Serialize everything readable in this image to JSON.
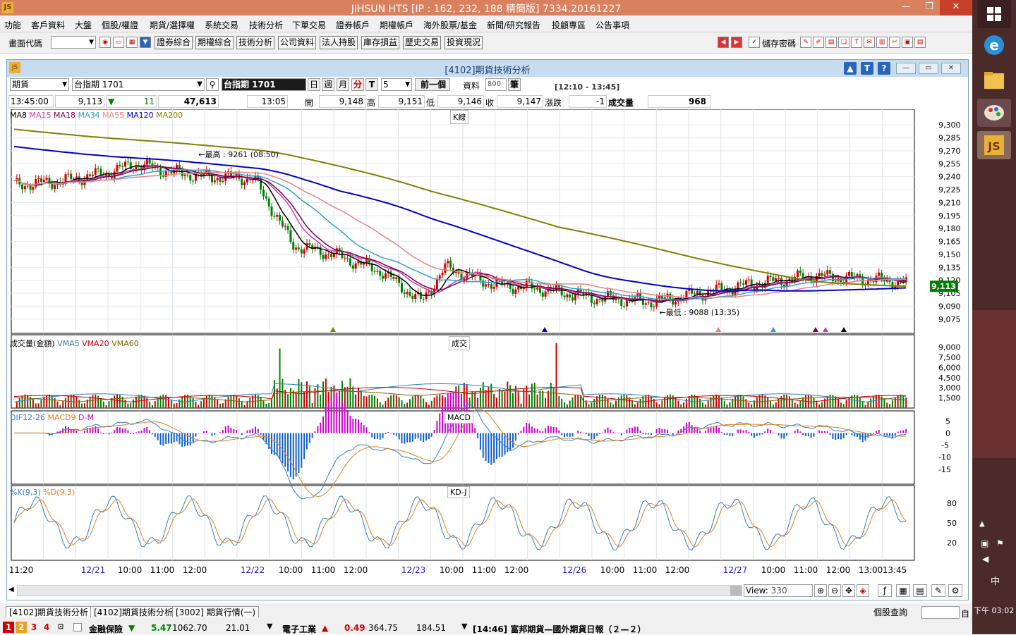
{
  "window": {
    "title": "JIHSUN HTS      [IP : 162, 232, 188 精簡版] 7334.20161227"
  },
  "menu": [
    "功能",
    "客戶資料",
    "大盤",
    "個股/權證",
    "期貨/選擇權",
    "系統交易",
    "技術分析",
    "下單交易",
    "證券帳戶",
    "期權帳戶",
    "海外股票/基金",
    "新聞/研究報告",
    "投顧專區",
    "公告事項"
  ],
  "toolbar": {
    "code_label": "畫面代碼",
    "buttons": [
      "證券綜合",
      "期權綜合",
      "技術分析",
      "公司資料",
      "法人持股",
      "庫存損益",
      "歷史交易",
      "投資現況"
    ],
    "save_password": "儲存密碼"
  },
  "chart_window": {
    "title": "[4102]期貨技術分析",
    "product_type": "期貨",
    "symbol": "台指期 1701",
    "symbol_display": "台指期 1701",
    "periods": [
      "日",
      "週",
      "月",
      "分",
      "T"
    ],
    "minutes": "5",
    "prev_label": "前一個",
    "data_label": "資料",
    "data_count": "800",
    "bars_label": "筆",
    "range": "[12:10 - 13:45]"
  },
  "quote": {
    "time": "13:45:00",
    "last": "9,113",
    "change_arrow": "▼",
    "change": "11",
    "volume_total": "47,613",
    "bar_time": "13:05",
    "open_label": "開",
    "open": "9,148",
    "high_label": "高",
    "high": "9,151",
    "low_label": "低",
    "low": "9,146",
    "close_label": "收",
    "close": "9,147",
    "chg_label": "漲跌",
    "chg": "-1",
    "vol_label": "成交量",
    "vol": "968"
  },
  "price_panel": {
    "name": "K線",
    "legend": [
      {
        "label": "MA8",
        "color": "#000000"
      },
      {
        "label": "MA15",
        "color": "#c040c0"
      },
      {
        "label": "MA18",
        "color": "#800040"
      },
      {
        "label": "MA34",
        "color": "#30a0d0"
      },
      {
        "label": "MA55",
        "color": "#f08080"
      },
      {
        "label": "MA120",
        "color": "#0000c0"
      },
      {
        "label": "MA200",
        "color": "#808000"
      }
    ],
    "y_ticks": [
      "9,300",
      "9,285",
      "9,270",
      "9,255",
      "9,240",
      "9,225",
      "9,210",
      "9,195",
      "9,180",
      "9,165",
      "9,150",
      "9,135",
      "9,120",
      "9,105",
      "9,090",
      "9,075"
    ],
    "high_note": "最高 : 9261 (08:50)",
    "low_note": "最低 : 9088 (13:35)",
    "last_tag": "9,113"
  },
  "volume_panel": {
    "name": "成交",
    "legend": [
      {
        "label": "成交量(金額)",
        "color": "#000000"
      },
      {
        "label": "VMA5",
        "color": "#3080c0"
      },
      {
        "label": "VMA20",
        "color": "#d00000"
      },
      {
        "label": "VMA60",
        "color": "#806000"
      }
    ],
    "y_ticks": [
      "9,000",
      "7,500",
      "6,000",
      "4,500",
      "3,000",
      "1,500"
    ]
  },
  "macd_panel": {
    "name": "MACD",
    "legend": [
      {
        "label": "DIF12-26",
        "color": "#3080c0"
      },
      {
        "label": "MACD9",
        "color": "#e08020"
      },
      {
        "label": "D-M",
        "color": "#d000d0"
      }
    ],
    "y_ticks": [
      "5",
      "0",
      "-5",
      "-10",
      "-15"
    ]
  },
  "kd_panel": {
    "name": "KD-J",
    "legend": [
      {
        "label": "%K(9,3)",
        "color": "#3080c0"
      },
      {
        "label": "%D(9,3)",
        "color": "#e08020"
      }
    ],
    "y_ticks": [
      "80",
      "50",
      "20"
    ]
  },
  "x_axis": [
    {
      "label": "11:20",
      "blue": false
    },
    {
      "label": "12/21",
      "blue": true
    },
    {
      "label": "10:00",
      "blue": false
    },
    {
      "label": "11:00",
      "blue": false
    },
    {
      "label": "12:00",
      "blue": false
    },
    {
      "label": "12/22",
      "blue": true
    },
    {
      "label": "10:00",
      "blue": false
    },
    {
      "label": "11:00",
      "blue": false
    },
    {
      "label": "12:00",
      "blue": false
    },
    {
      "label": "12/23",
      "blue": true
    },
    {
      "label": "10:00",
      "blue": false
    },
    {
      "label": "11:00",
      "blue": false
    },
    {
      "label": "12:00",
      "blue": false
    },
    {
      "label": "12/26",
      "blue": true
    },
    {
      "label": "10:00",
      "blue": false
    },
    {
      "label": "11:00",
      "blue": false
    },
    {
      "label": "12:00",
      "blue": false
    },
    {
      "label": "12/27",
      "blue": true
    },
    {
      "label": "10:00",
      "blue": false
    },
    {
      "label": "11:00",
      "blue": false
    },
    {
      "label": "12:00",
      "blue": false
    },
    {
      "label": "13:00",
      "blue": false
    },
    {
      "label": "13:45",
      "blue": false
    }
  ],
  "view": {
    "label": "View:",
    "value": "330"
  },
  "tabs": [
    "[4102]期貨技術分析",
    "[4102]期貨技術分析",
    "[3002] 期貨行情(一)"
  ],
  "ticker": {
    "pages": [
      "1",
      "2",
      "3",
      "4"
    ],
    "item1_name": "金融保險",
    "item1_arrow": "▼",
    "item1_chg": "5.47",
    "item1_idx": "1062.70",
    "item1_vol": "21.01",
    "item2_name": "電子工業",
    "item2_arrow": "▲",
    "item2_chg": "0.49",
    "item2_idx": "364.75",
    "item2_vol": "184.51",
    "news": "[14:46] 富邦期貨—國外期貨日報（２—２）",
    "lookup_label": "個股查詢"
  },
  "taskbar": {
    "ime": "中",
    "time": "下午 03:02"
  }
}
